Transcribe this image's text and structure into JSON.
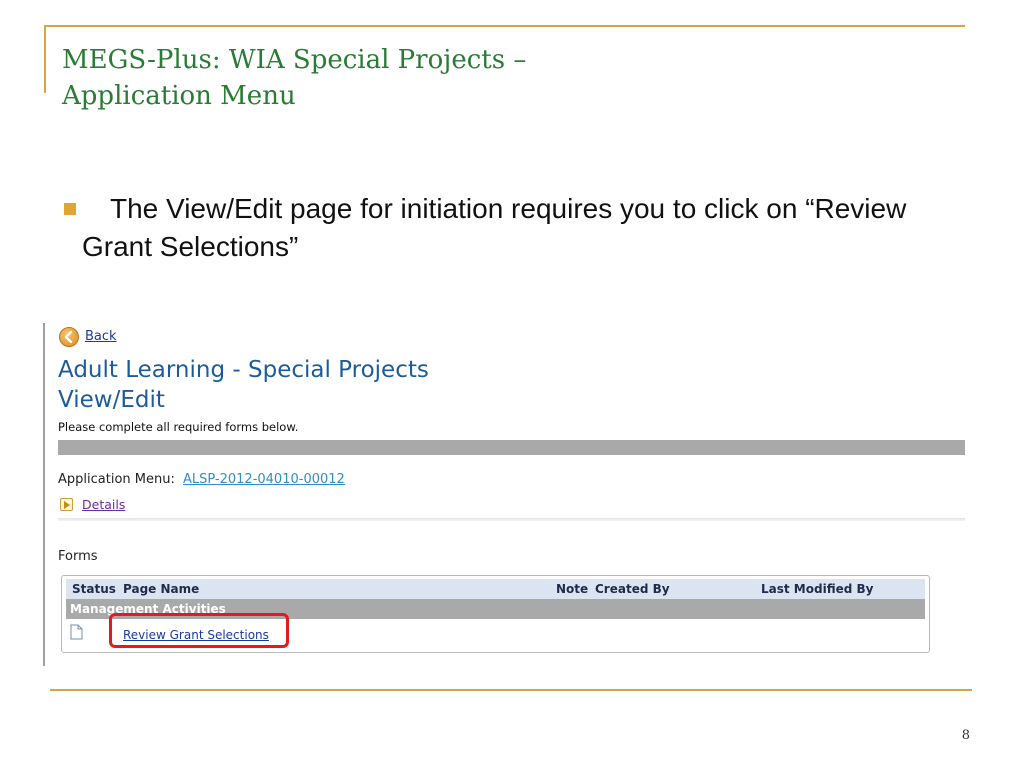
{
  "slide": {
    "title_line1": "MEGS-Plus: WIA Special Projects –",
    "title_line2": "Application Menu",
    "bullet": "The View/Edit page for initiation requires you to click on “Review Grant Selections”",
    "page_number": "8",
    "accent_color": "#d9a441",
    "title_color": "#2a7b35"
  },
  "screenshot": {
    "back_label": "Back",
    "back_icon": "back-arrow-circle-icon",
    "page_title_line1": "Adult Learning - Special Projects",
    "page_title_line2": "View/Edit",
    "instructions": "Please complete all required forms below.",
    "application_menu_label": "Application Menu:",
    "application_id": "ALSP-2012-04010-00012",
    "details_label": "Details",
    "forms_label": "Forms",
    "table": {
      "headers": [
        "Status",
        "Page Name",
        "Note",
        "Created By",
        "Last Modified By"
      ],
      "group": "Management Activities",
      "rows": [
        {
          "status_icon": "document-icon",
          "page_name": "Review Grant Selections"
        }
      ]
    },
    "highlight_color": "#e01c1c"
  }
}
